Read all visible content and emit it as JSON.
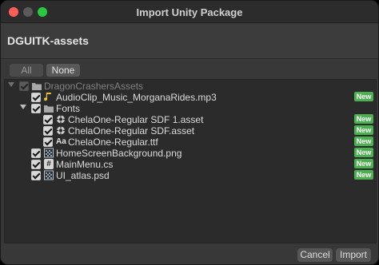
{
  "window": {
    "title": "Import Unity Package"
  },
  "package": {
    "name": "DGUITK-assets"
  },
  "toolbar": {
    "all_label": "All",
    "none_label": "None"
  },
  "tree": [
    {
      "label": "DragonCrashersAssets",
      "icon": "folder-icon",
      "dim": true,
      "foldout": true,
      "depth": 0,
      "new": false
    },
    {
      "label": "AudioClip_Music_MorganaRides.mp3",
      "icon": "audio-clip-icon",
      "dim": false,
      "foldout": false,
      "depth": 1,
      "new": true
    },
    {
      "label": "Fonts",
      "icon": "folder-icon",
      "dim": false,
      "foldout": true,
      "depth": 1,
      "new": false
    },
    {
      "label": "ChelaOne-Regular SDF 1.asset",
      "icon": "font-asset-icon",
      "dim": false,
      "foldout": false,
      "depth": 2,
      "new": true
    },
    {
      "label": "ChelaOne-Regular SDF.asset",
      "icon": "font-asset-icon",
      "dim": false,
      "foldout": false,
      "depth": 2,
      "new": true
    },
    {
      "label": "ChelaOne-Regular.ttf",
      "icon": "font-file-icon",
      "dim": false,
      "foldout": false,
      "depth": 2,
      "new": true
    },
    {
      "label": "HomeScreenBackground.png",
      "icon": "texture-icon",
      "dim": false,
      "foldout": false,
      "depth": 1,
      "new": true
    },
    {
      "label": "MainMenu.cs",
      "icon": "csharp-script-icon",
      "dim": false,
      "foldout": false,
      "depth": 1,
      "new": true
    },
    {
      "label": "UI_atlas.psd",
      "icon": "texture-icon",
      "dim": false,
      "foldout": false,
      "depth": 1,
      "new": true
    }
  ],
  "new_badge": "New",
  "font_glyph": "Aa",
  "script_glyph": "#",
  "footer": {
    "cancel_label": "Cancel",
    "import_label": "Import"
  },
  "colors": {
    "new_badge": "#4caf50",
    "close": "#ff5f57",
    "maximize": "#28c840",
    "folder": "#a8a8a8",
    "audio": "#e8c23a"
  }
}
